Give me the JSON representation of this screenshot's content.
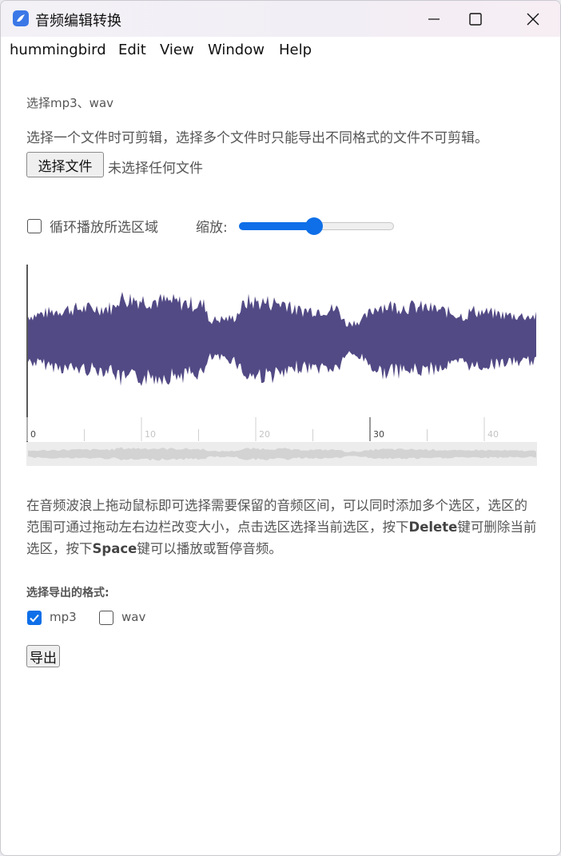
{
  "window": {
    "title": "音频编辑转换"
  },
  "menu": [
    "hummingbird",
    "Edit",
    "View",
    "Window",
    "Help"
  ],
  "select_label": "选择mp3、wav",
  "description_1": "选择一个文件时可剪辑，选择多个文件时只能导出不同格式的文件不可剪辑。",
  "file_input": {
    "button": "选择文件",
    "status": "未选择任何文件"
  },
  "loop": {
    "label": "循环播放所选区域",
    "checked": false
  },
  "zoom": {
    "label": "缩放:",
    "value": 0.48
  },
  "timeline": {
    "ticks": [
      "0",
      "10",
      "20",
      "30",
      "40"
    ]
  },
  "description_2": {
    "part1": "在音频波浪上拖动鼠标即可选择需要保留的音频区间，可以同时添加多个选区，选区的范围可通过拖动左右边栏改变大小，点击选区选择当前选区，按下",
    "key1": "Delete",
    "part2": "键可删除当前选区，按下",
    "key2": "Space",
    "part3": "键可以播放或暂停音频。"
  },
  "export_format": {
    "label": "选择导出的格式:",
    "options": [
      {
        "label": "mp3",
        "checked": true
      },
      {
        "label": "wav",
        "checked": false
      }
    ]
  },
  "export_button": "导出",
  "colors": {
    "wave": "#524a85",
    "accent": "#0f6fe8",
    "minimap": "#d7d7d7"
  }
}
